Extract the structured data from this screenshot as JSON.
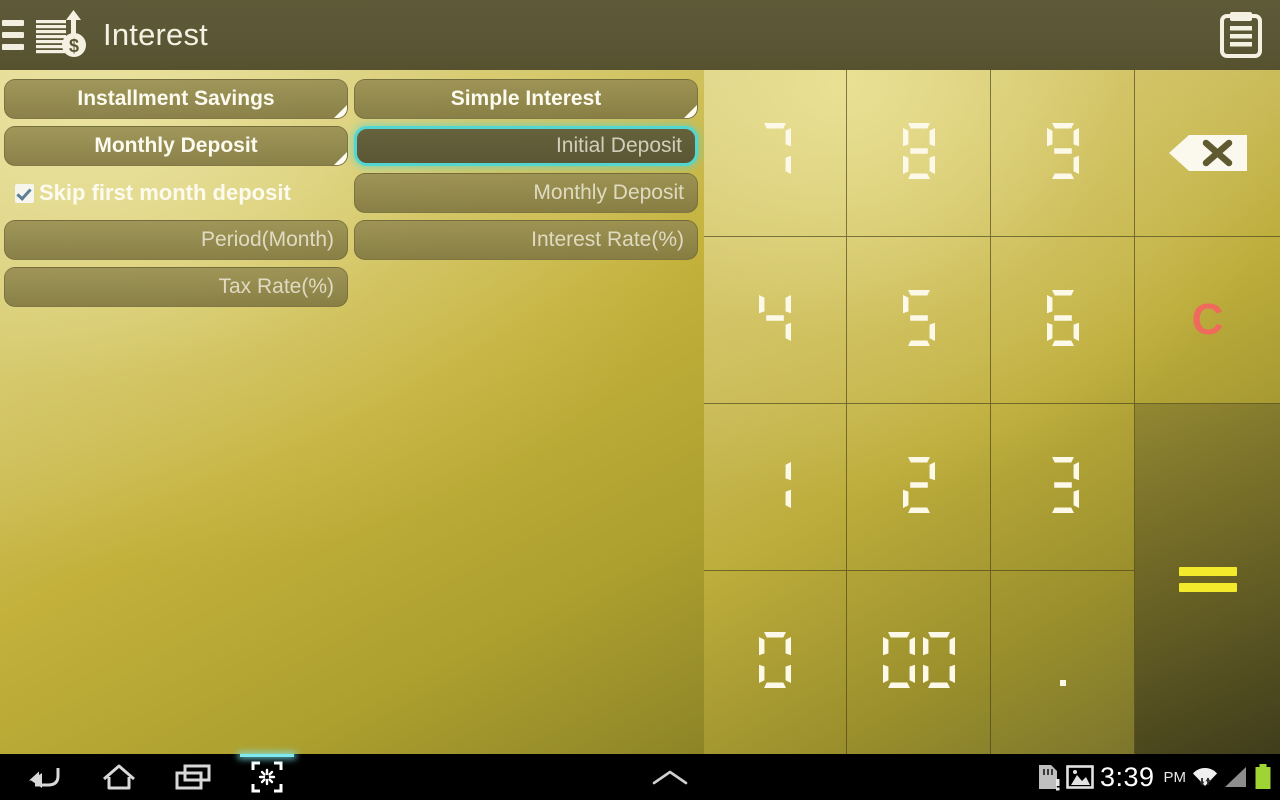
{
  "header": {
    "title": "Interest",
    "menu_icon": "hamburger-menu-icon",
    "app_icon": "interest-coins-dollar-icon",
    "notes_icon": "clipboard-notes-icon"
  },
  "form": {
    "rows": [
      {
        "left": {
          "type": "spinner",
          "label": "Installment Savings",
          "kind": "product-type-spinner"
        },
        "right": {
          "type": "spinner",
          "label": "Simple Interest",
          "kind": "interest-type-spinner"
        }
      },
      {
        "left": {
          "type": "spinner",
          "label": "Monthly Deposit",
          "kind": "deposit-type-spinner"
        },
        "right": {
          "type": "field",
          "placeholder": "Initial Deposit",
          "value": "",
          "focused": true,
          "kind": "initial-deposit-field"
        }
      },
      {
        "left": {
          "type": "checkbox",
          "label": "Skip first month deposit",
          "checked": true,
          "kind": "skip-first-month-checkbox"
        },
        "right": {
          "type": "field",
          "placeholder": "Monthly Deposit",
          "value": "",
          "focused": false,
          "kind": "monthly-deposit-field"
        }
      },
      {
        "left": {
          "type": "field",
          "placeholder": "Period(Month)",
          "value": "",
          "focused": false,
          "kind": "period-month-field"
        },
        "right": {
          "type": "field",
          "placeholder": "Interest Rate(%)",
          "value": "",
          "focused": false,
          "kind": "interest-rate-field"
        }
      },
      {
        "left": {
          "type": "field",
          "placeholder": "Tax Rate(%)",
          "value": "",
          "focused": false,
          "kind": "tax-rate-field"
        },
        "right": null
      }
    ]
  },
  "keypad": {
    "keys": [
      {
        "label": "7",
        "type": "digit",
        "name": "key-7"
      },
      {
        "label": "8",
        "type": "digit",
        "name": "key-8"
      },
      {
        "label": "9",
        "type": "digit",
        "name": "key-9"
      },
      {
        "label": "",
        "type": "backspace",
        "name": "key-backspace",
        "icon": "backspace-icon"
      },
      {
        "label": "4",
        "type": "digit",
        "name": "key-4"
      },
      {
        "label": "5",
        "type": "digit",
        "name": "key-5"
      },
      {
        "label": "6",
        "type": "digit",
        "name": "key-6"
      },
      {
        "label": "C",
        "type": "clear",
        "name": "key-clear"
      },
      {
        "label": "1",
        "type": "digit",
        "name": "key-1"
      },
      {
        "label": "2",
        "type": "digit",
        "name": "key-2"
      },
      {
        "label": "3",
        "type": "digit",
        "name": "key-3"
      },
      {
        "label": "=",
        "type": "equals",
        "name": "key-equals",
        "icon": "equals-icon"
      },
      {
        "label": "0",
        "type": "digit",
        "name": "key-0"
      },
      {
        "label": "00",
        "type": "digit",
        "name": "key-double-zero"
      },
      {
        "label": ".",
        "type": "decimal",
        "name": "key-decimal"
      }
    ],
    "clear_color": "#ef6a5c",
    "equals_color": "#f2ea2a"
  },
  "navbar": {
    "back": "back-icon",
    "home": "home-icon",
    "recents": "recent-apps-icon",
    "screenshot": "screenshot-capture-icon",
    "expand": "chevron-up-icon",
    "status": {
      "sdcard": "sdcard-alert-icon",
      "screenshot_saved": "image-icon",
      "time": "3:39",
      "ampm": "PM",
      "wifi": "wifi-icon",
      "signal": "signal-icon",
      "battery": "battery-icon",
      "battery_color": "#9fd435"
    }
  }
}
